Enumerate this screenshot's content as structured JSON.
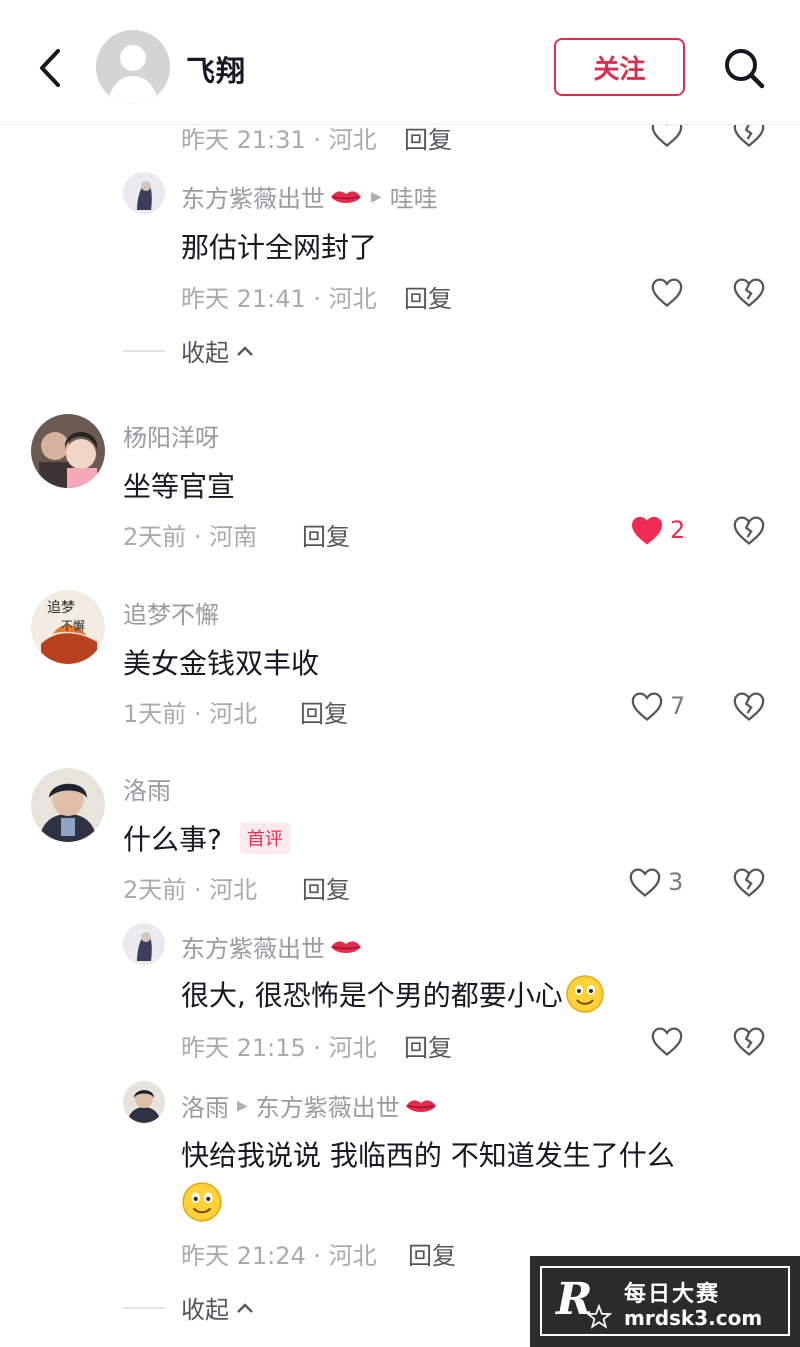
{
  "header": {
    "title": "飞翔",
    "follow_label": "关注"
  },
  "comments": [
    {
      "meta": "昨天 21:31 · 河北",
      "reply_label": "回复"
    },
    {
      "user": "东方紫薇出世",
      "reply_to": "哇哇",
      "text": "那估计全网封了",
      "meta": "昨天 21:41 · 河北",
      "reply_label": "回复"
    },
    {
      "collapse_label": "收起"
    },
    {
      "user": "杨阳洋呀",
      "text": "坐等官宣",
      "meta": "2天前 · 河南",
      "reply_label": "回复",
      "likes": "2",
      "liked": true
    },
    {
      "user": "追梦不懈",
      "text": "美女金钱双丰收",
      "meta": "1天前 · 河北",
      "reply_label": "回复",
      "likes": "7"
    },
    {
      "user": "洛雨",
      "text": "什么事?",
      "badge": "首评",
      "meta": "2天前 · 河北",
      "reply_label": "回复",
      "likes": "3"
    },
    {
      "user": "东方紫薇出世",
      "text": "很大, 很恐怖是个男的都要小心",
      "meta": "昨天 21:15 · 河北",
      "reply_label": "回复"
    },
    {
      "user": "洛雨",
      "reply_to": "东方紫薇出世",
      "text": "快给我说说 我临西的 不知道发生了什么",
      "meta": "昨天 21:24 · 河北",
      "reply_label": "回复"
    },
    {
      "collapse_label": "收起"
    }
  ],
  "watermark": {
    "logo_letter": "R",
    "line1": "每日大赛",
    "line2": "mrdsk3.com"
  },
  "colors": {
    "accent": "#d8314f",
    "like_red": "#f02a51",
    "muted_text": "#a9aaaf"
  },
  "icons": [
    "back-chevron-icon",
    "search-icon",
    "heart-icon",
    "broken-heart-icon",
    "lips-emoji",
    "smile-emoji",
    "chevron-up-icon",
    "reply-arrow-icon"
  ]
}
